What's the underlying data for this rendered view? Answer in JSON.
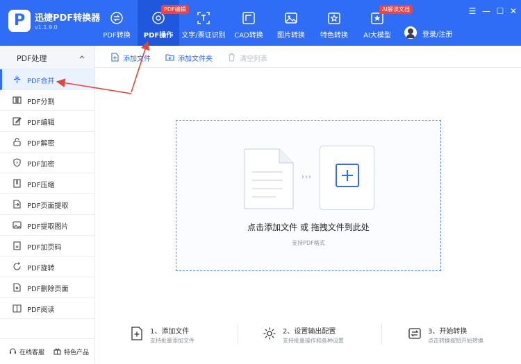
{
  "app": {
    "name": "迅捷PDF转换器",
    "version": "v1.1.9.0",
    "logo_letter": "P"
  },
  "nav": {
    "tabs": [
      {
        "label": "PDF转换",
        "icon": "convert-icon",
        "active": false
      },
      {
        "label": "PDF操作",
        "icon": "pdf-operate-icon",
        "active": true,
        "badge": "PDF编辑"
      },
      {
        "label": "文字/票证识别",
        "icon": "ocr-icon",
        "active": false
      },
      {
        "label": "CAD转换",
        "icon": "cad-icon",
        "active": false
      },
      {
        "label": "图片转换",
        "icon": "image-icon",
        "active": false
      },
      {
        "label": "特色转换",
        "icon": "star-icon",
        "active": false
      },
      {
        "label": "AI大模型",
        "icon": "ai-icon",
        "active": false,
        "badge": "AI解读文档"
      }
    ],
    "login_label": "登录/注册"
  },
  "window_controls": {
    "menu": "☰",
    "minimize": "—",
    "maximize": "☐",
    "close": "✕"
  },
  "sidebar": {
    "header": "PDF处理",
    "items": [
      {
        "label": "PDF合并",
        "icon": "merge-icon",
        "active": true
      },
      {
        "label": "PDF分割",
        "icon": "split-icon"
      },
      {
        "label": "PDF编辑",
        "icon": "edit-icon"
      },
      {
        "label": "PDF解密",
        "icon": "unlock-icon"
      },
      {
        "label": "PDF加密",
        "icon": "shield-icon"
      },
      {
        "label": "PDF压缩",
        "icon": "compress-icon"
      },
      {
        "label": "PDF页面提取",
        "icon": "page-extract-icon"
      },
      {
        "label": "PDF提取图片",
        "icon": "extract-image-icon"
      },
      {
        "label": "PDF加页码",
        "icon": "page-number-icon"
      },
      {
        "label": "PDF旋转",
        "icon": "rotate-icon"
      },
      {
        "label": "PDF删除页面",
        "icon": "delete-page-icon"
      },
      {
        "label": "PDF阅读",
        "icon": "read-icon"
      }
    ],
    "footer": {
      "service": "在线客服",
      "featured": "特色产品"
    }
  },
  "toolbar": {
    "add_file": "添加文件",
    "add_folder": "添加文件夹",
    "clear_list": "清空列表"
  },
  "dropzone": {
    "arrows": "›››",
    "title": "点击添加文件 或 拖拽文件到此处",
    "subtitle": "支持PDF格式"
  },
  "steps": [
    {
      "title": "1、添加文件",
      "desc": "支持批量添加文件",
      "icon": "add-file-icon"
    },
    {
      "title": "2、设置输出配置",
      "desc": "支持批量操作和各种设置",
      "icon": "settings-gear-icon"
    },
    {
      "title": "3、开始转换",
      "desc": "点击转换按钮开始转换",
      "icon": "convert-start-icon"
    }
  ],
  "colors": {
    "brand": "#2f6df6",
    "brand_dark": "#1f57dd",
    "badge": "#f24141",
    "annotation_arrow": "#e0463a"
  }
}
